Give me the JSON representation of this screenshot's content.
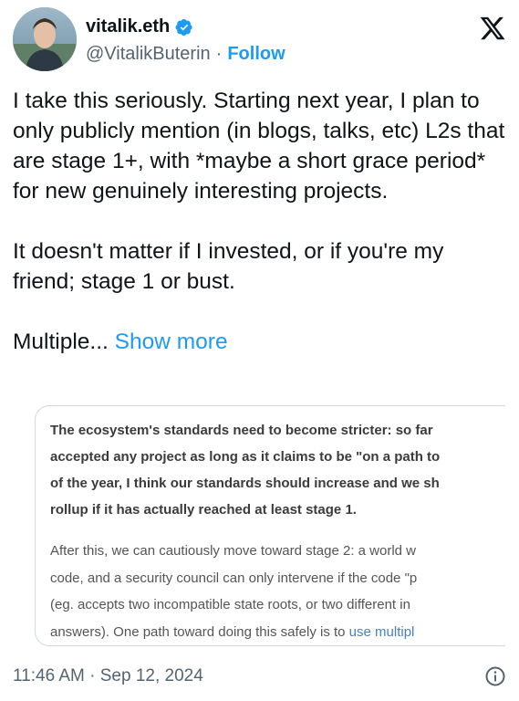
{
  "author": {
    "display_name": "vitalik.eth",
    "handle": "@VitalikButerin",
    "separator": "·",
    "follow_label": "Follow"
  },
  "tweet": {
    "paragraphs": [
      "I take this seriously. Starting next year, I plan to only publicly mention (in blogs, talks, etc) L2s that are stage 1+, with *maybe a short grace period* for new genuinely interesting projects.",
      "It doesn't matter if I invested, or if you're my friend; stage 1 or bust."
    ],
    "truncated_text": "Multiple...",
    "show_more_label": "Show more"
  },
  "quote_image": {
    "bold_lines": [
      "The ecosystem's standards need to become stricter: so far",
      "accepted any project as long as it claims to be \"on a path to",
      "of the year, I think our standards should increase and we sh",
      "rollup if it has actually reached at least stage 1."
    ],
    "normal_lines": [
      "After this, we can cautiously move toward stage 2: a world w",
      "code, and a security council can only intervene if the code \"p",
      "(eg. accepts two incompatible state roots, or two different in"
    ],
    "last_line_prefix": "answers). One path toward doing this safely is to ",
    "last_line_link": "use multipl"
  },
  "footer": {
    "timestamp": "11:46 AM · Sep 12, 2024"
  },
  "colors": {
    "accent": "#1d9bf0",
    "text": "#0f1419",
    "muted": "#536471",
    "border": "#cfd9de"
  },
  "icons": {
    "brand": "x-logo-icon",
    "verified": "verified-badge-icon",
    "info": "info-icon"
  }
}
